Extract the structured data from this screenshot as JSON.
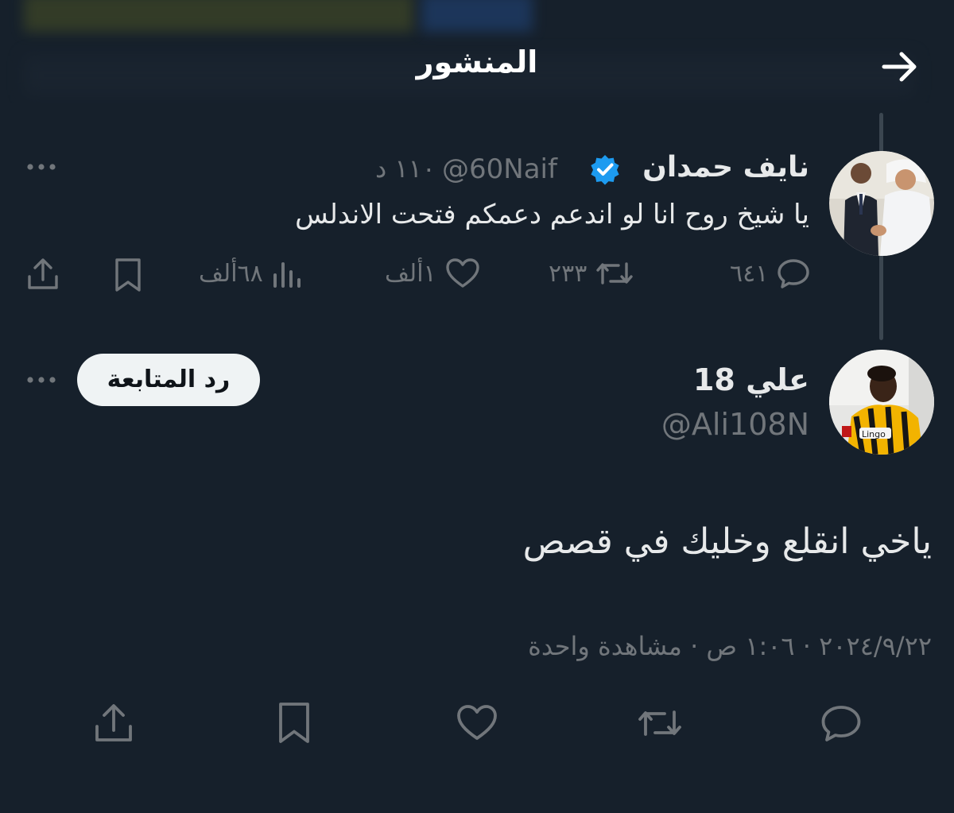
{
  "header": {
    "title": "المنشور"
  },
  "parent_tweet": {
    "author_name": "نايف حمدان",
    "handle": "@60Naif",
    "time": "١١٠ د",
    "text": "يا شيخ روح انا لو اندعم دعمكم فتحت الاندلس",
    "replies": "٦٤١",
    "retweets": "٢٣٣",
    "likes": "١ألف",
    "views": "٦٨ألف"
  },
  "reply_tweet": {
    "author_name": "علي 18",
    "handle": "@Ali108N",
    "follow_label": "رد المتابعة",
    "text": "ياخي انقلع وخليك في قصص",
    "meta": "٢٠٢٤/٩/٢٢ · ١:٠٦ ص · مشاهدة واحدة"
  },
  "colors": {
    "background": "#16202b",
    "text": "#e7e9ea",
    "muted": "#71767b",
    "verified": "#1d9bf0",
    "follow_button_bg": "#eff3f4"
  }
}
